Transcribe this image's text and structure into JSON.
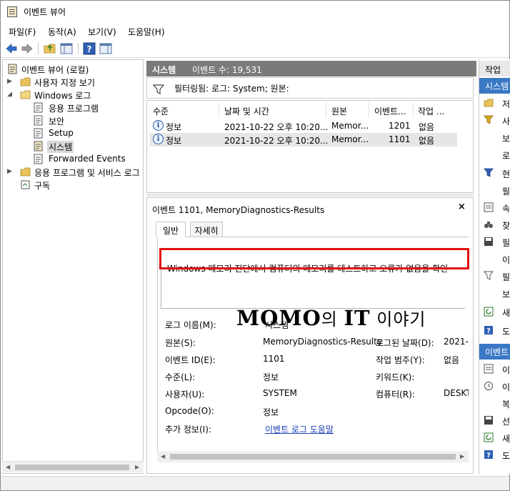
{
  "window": {
    "title": "이벤트 뷰어"
  },
  "menu": [
    "파일(F)",
    "동작(A)",
    "보기(V)",
    "도움말(H)"
  ],
  "tree": {
    "items": [
      {
        "label": "이벤트 뷰어 (로컬)",
        "level": 0
      },
      {
        "label": "사용자 지정 보기",
        "level": 1
      },
      {
        "label": "Windows 로그",
        "level": 1
      },
      {
        "label": "응용 프로그램",
        "level": 2
      },
      {
        "label": "보안",
        "level": 2
      },
      {
        "label": "Setup",
        "level": 2
      },
      {
        "label": "시스템",
        "level": 2,
        "selected": true
      },
      {
        "label": "Forwarded Events",
        "level": 2
      },
      {
        "label": "응용 프로그램 및 서비스 로그",
        "level": 1
      },
      {
        "label": "구독",
        "level": 1
      }
    ]
  },
  "mid": {
    "header_name": "시스템",
    "header_count": "이벤트 수: 19,531",
    "filter_text": "필터링됨: 로그: System; 원본:"
  },
  "event_list": {
    "columns": [
      "수준",
      "날짜 및 시간",
      "원본",
      "이벤트...",
      "작업 ..."
    ],
    "rows": [
      {
        "level": "정보",
        "datetime": "2021-10-22 오후 10:20...",
        "source": "Memor...",
        "event_id": "1201",
        "task": "없음"
      },
      {
        "level": "정보",
        "datetime": "2021-10-22 오후 10:20...",
        "source": "Memor...",
        "event_id": "1101",
        "task": "없음"
      }
    ]
  },
  "details": {
    "title": "이벤트 1101, MemoryDiagnostics-Results",
    "close": "×",
    "tabs": [
      "일반",
      "자세히"
    ],
    "description": "Windows 메모리 진단에서 컴퓨터의 메모리를 테스트하고 오류가 없음을 확인",
    "props": {
      "log_name_label": "로그 이름(M):",
      "log_name_value": "시스템",
      "source_label": "원본(S):",
      "source_value": "MemoryDiagnostics-Results",
      "logged_label": "로그된 날짜(D):",
      "logged_value": "2021-",
      "event_id_label": "이벤트 ID(E):",
      "event_id_value": "1101",
      "task_label": "작업 범주(Y):",
      "task_value": "없음",
      "level_label": "수준(L):",
      "level_value": "정보",
      "keyword_label": "키워드(K):",
      "user_label": "사용자(U):",
      "user_value": "SYSTEM",
      "computer_label": "컴퓨터(R):",
      "computer_value": "DESKT",
      "opcode_label": "Opcode(O):",
      "opcode_value": "정보",
      "more_label": "추가 정보(I):",
      "more_link": "이벤트 로그 도움말"
    }
  },
  "watermark": {
    "brand": "MOMO",
    "mid": "의 ",
    "it": "IT",
    "tail": " 이야기"
  },
  "actions": {
    "header": "작업",
    "section1": "시스템",
    "section2": "이벤트",
    "items1": [
      "저",
      "사",
      "보",
      "로",
      "현",
      "필",
      "속",
      "찾",
      "필",
      "이",
      "필",
      "보",
      "새",
      "도"
    ],
    "items2": [
      "이",
      "이",
      "복",
      "선",
      "새",
      "도"
    ]
  },
  "colors": {
    "accent": "#3a78c4",
    "header_gray": "#7a7a7a",
    "highlight_red": "#e01010",
    "link": "#1a3fb7"
  }
}
